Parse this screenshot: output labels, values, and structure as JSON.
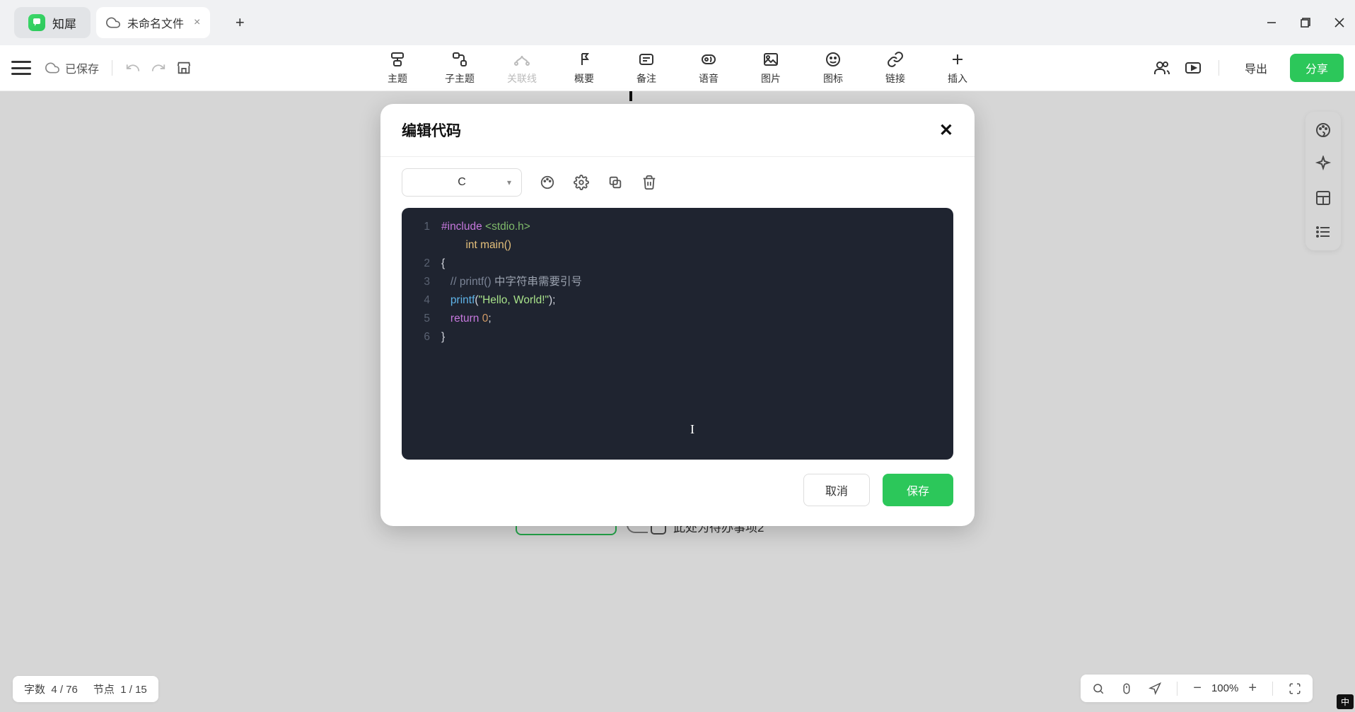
{
  "app": {
    "name": "知犀"
  },
  "tabs": {
    "document": "未命名文件"
  },
  "toolbar": {
    "saved": "已保存",
    "items": [
      {
        "label": "主题"
      },
      {
        "label": "子主题"
      },
      {
        "label": "关联线",
        "disabled": true
      },
      {
        "label": "概要"
      },
      {
        "label": "备注"
      },
      {
        "label": "语音"
      },
      {
        "label": "图片"
      },
      {
        "label": "图标"
      },
      {
        "label": "链接"
      },
      {
        "label": "插入"
      }
    ],
    "export": "导出",
    "share": "分享"
  },
  "modal": {
    "title": "编辑代码",
    "language": "C",
    "code": {
      "lines": [
        {
          "n": "1",
          "segments": [
            {
              "t": "#include ",
              "c": "tok-pre"
            },
            {
              "t": "<stdio.h>",
              "c": "tok-inc"
            }
          ],
          "extra": "        int main()"
        },
        {
          "n": "2",
          "segments": [
            {
              "t": "{",
              "c": ""
            }
          ]
        },
        {
          "n": "3",
          "segments": [
            {
              "t": "   ",
              "c": ""
            },
            {
              "t": "// printf() ",
              "c": "tok-com"
            },
            {
              "t": "中字符串需要引号",
              "c": "tok-comcn"
            }
          ]
        },
        {
          "n": "4",
          "segments": [
            {
              "t": "   ",
              "c": ""
            },
            {
              "t": "printf",
              "c": "tok-fn"
            },
            {
              "t": "(",
              "c": ""
            },
            {
              "t": "\"Hello, World!\"",
              "c": "tok-str"
            },
            {
              "t": ");",
              "c": ""
            }
          ]
        },
        {
          "n": "5",
          "segments": [
            {
              "t": "   ",
              "c": ""
            },
            {
              "t": "return ",
              "c": "tok-ret"
            },
            {
              "t": "0",
              "c": "tok-num"
            },
            {
              "t": ";",
              "c": ""
            }
          ]
        },
        {
          "n": "6",
          "segments": [
            {
              "t": "}",
              "c": ""
            }
          ]
        }
      ]
    },
    "cancel": "取消",
    "save": "保存"
  },
  "canvas": {
    "todo_text": "此处为待办事项2"
  },
  "status": {
    "words_label": "字数",
    "words": "4 / 76",
    "nodes_label": "节点",
    "nodes": "1 / 15",
    "zoom": "100%"
  },
  "ime": "中"
}
